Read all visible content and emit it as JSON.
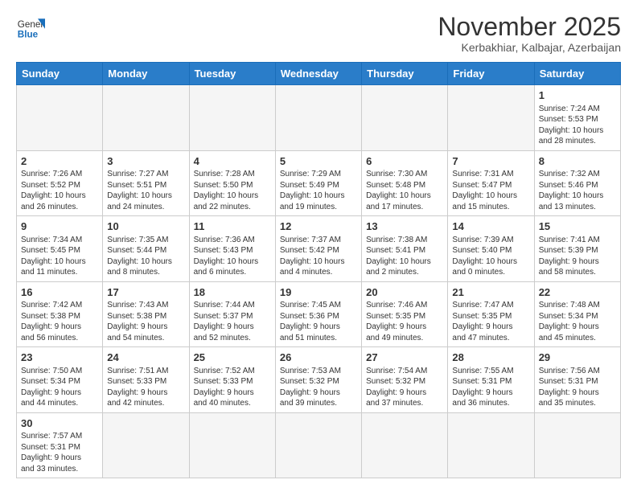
{
  "header": {
    "logo": {
      "general": "General",
      "blue": "Blue"
    },
    "title": "November 2025",
    "location": "Kerbakhiar, Kalbajar, Azerbaijan"
  },
  "weekdays": [
    "Sunday",
    "Monday",
    "Tuesday",
    "Wednesday",
    "Thursday",
    "Friday",
    "Saturday"
  ],
  "weeks": [
    [
      {
        "day": "",
        "info": ""
      },
      {
        "day": "",
        "info": ""
      },
      {
        "day": "",
        "info": ""
      },
      {
        "day": "",
        "info": ""
      },
      {
        "day": "",
        "info": ""
      },
      {
        "day": "",
        "info": ""
      },
      {
        "day": "1",
        "info": "Sunrise: 7:24 AM\nSunset: 5:53 PM\nDaylight: 10 hours\nand 28 minutes."
      }
    ],
    [
      {
        "day": "2",
        "info": "Sunrise: 7:26 AM\nSunset: 5:52 PM\nDaylight: 10 hours\nand 26 minutes."
      },
      {
        "day": "3",
        "info": "Sunrise: 7:27 AM\nSunset: 5:51 PM\nDaylight: 10 hours\nand 24 minutes."
      },
      {
        "day": "4",
        "info": "Sunrise: 7:28 AM\nSunset: 5:50 PM\nDaylight: 10 hours\nand 22 minutes."
      },
      {
        "day": "5",
        "info": "Sunrise: 7:29 AM\nSunset: 5:49 PM\nDaylight: 10 hours\nand 19 minutes."
      },
      {
        "day": "6",
        "info": "Sunrise: 7:30 AM\nSunset: 5:48 PM\nDaylight: 10 hours\nand 17 minutes."
      },
      {
        "day": "7",
        "info": "Sunrise: 7:31 AM\nSunset: 5:47 PM\nDaylight: 10 hours\nand 15 minutes."
      },
      {
        "day": "8",
        "info": "Sunrise: 7:32 AM\nSunset: 5:46 PM\nDaylight: 10 hours\nand 13 minutes."
      }
    ],
    [
      {
        "day": "9",
        "info": "Sunrise: 7:34 AM\nSunset: 5:45 PM\nDaylight: 10 hours\nand 11 minutes."
      },
      {
        "day": "10",
        "info": "Sunrise: 7:35 AM\nSunset: 5:44 PM\nDaylight: 10 hours\nand 8 minutes."
      },
      {
        "day": "11",
        "info": "Sunrise: 7:36 AM\nSunset: 5:43 PM\nDaylight: 10 hours\nand 6 minutes."
      },
      {
        "day": "12",
        "info": "Sunrise: 7:37 AM\nSunset: 5:42 PM\nDaylight: 10 hours\nand 4 minutes."
      },
      {
        "day": "13",
        "info": "Sunrise: 7:38 AM\nSunset: 5:41 PM\nDaylight: 10 hours\nand 2 minutes."
      },
      {
        "day": "14",
        "info": "Sunrise: 7:39 AM\nSunset: 5:40 PM\nDaylight: 10 hours\nand 0 minutes."
      },
      {
        "day": "15",
        "info": "Sunrise: 7:41 AM\nSunset: 5:39 PM\nDaylight: 9 hours\nand 58 minutes."
      }
    ],
    [
      {
        "day": "16",
        "info": "Sunrise: 7:42 AM\nSunset: 5:38 PM\nDaylight: 9 hours\nand 56 minutes."
      },
      {
        "day": "17",
        "info": "Sunrise: 7:43 AM\nSunset: 5:38 PM\nDaylight: 9 hours\nand 54 minutes."
      },
      {
        "day": "18",
        "info": "Sunrise: 7:44 AM\nSunset: 5:37 PM\nDaylight: 9 hours\nand 52 minutes."
      },
      {
        "day": "19",
        "info": "Sunrise: 7:45 AM\nSunset: 5:36 PM\nDaylight: 9 hours\nand 51 minutes."
      },
      {
        "day": "20",
        "info": "Sunrise: 7:46 AM\nSunset: 5:35 PM\nDaylight: 9 hours\nand 49 minutes."
      },
      {
        "day": "21",
        "info": "Sunrise: 7:47 AM\nSunset: 5:35 PM\nDaylight: 9 hours\nand 47 minutes."
      },
      {
        "day": "22",
        "info": "Sunrise: 7:48 AM\nSunset: 5:34 PM\nDaylight: 9 hours\nand 45 minutes."
      }
    ],
    [
      {
        "day": "23",
        "info": "Sunrise: 7:50 AM\nSunset: 5:34 PM\nDaylight: 9 hours\nand 44 minutes."
      },
      {
        "day": "24",
        "info": "Sunrise: 7:51 AM\nSunset: 5:33 PM\nDaylight: 9 hours\nand 42 minutes."
      },
      {
        "day": "25",
        "info": "Sunrise: 7:52 AM\nSunset: 5:33 PM\nDaylight: 9 hours\nand 40 minutes."
      },
      {
        "day": "26",
        "info": "Sunrise: 7:53 AM\nSunset: 5:32 PM\nDaylight: 9 hours\nand 39 minutes."
      },
      {
        "day": "27",
        "info": "Sunrise: 7:54 AM\nSunset: 5:32 PM\nDaylight: 9 hours\nand 37 minutes."
      },
      {
        "day": "28",
        "info": "Sunrise: 7:55 AM\nSunset: 5:31 PM\nDaylight: 9 hours\nand 36 minutes."
      },
      {
        "day": "29",
        "info": "Sunrise: 7:56 AM\nSunset: 5:31 PM\nDaylight: 9 hours\nand 35 minutes."
      }
    ],
    [
      {
        "day": "30",
        "info": "Sunrise: 7:57 AM\nSunset: 5:31 PM\nDaylight: 9 hours\nand 33 minutes."
      },
      {
        "day": "",
        "info": ""
      },
      {
        "day": "",
        "info": ""
      },
      {
        "day": "",
        "info": ""
      },
      {
        "day": "",
        "info": ""
      },
      {
        "day": "",
        "info": ""
      },
      {
        "day": "",
        "info": ""
      }
    ]
  ]
}
